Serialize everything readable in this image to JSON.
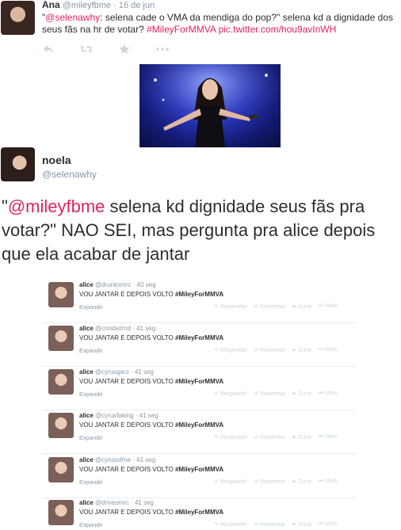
{
  "tweet1": {
    "name": "Ana",
    "handle": "@mileyfbme",
    "dot": "·",
    "date": "16 de jun",
    "text_open_quote": "\"",
    "mention": "@selenawhy",
    "text_body": ": selena cade o VMA da mendiga do pop?\" selena kd a dignidade dos seus fãs na hr de votar?",
    "hashtag": "#MileyForMMVA",
    "link": "pic.twitter.com/hou9avInWH",
    "actions": [
      "reply-icon",
      "retweet-icon",
      "favorite-icon",
      "more-icon"
    ]
  },
  "tweet2": {
    "name": "noela",
    "handle": "@selenawhy",
    "open_quote": "\"",
    "mention": "@mileyfbme",
    "text": " selena kd dignidade seus fãs pra votar?\" NAO SEI, mas pergunta pra alice depois que ela acabar de jantar"
  },
  "embedded_list": {
    "items": [
      {
        "name": "alice",
        "handle": "@drunksmrc",
        "time": "· 40 seg",
        "text": "VOU JANTAR E DEPOIS VOLTO",
        "hashtag": "#MileyForMMVA",
        "expand": "Expandir",
        "reply": "Responder",
        "retweet": "Retweetar",
        "fav": "Curtir",
        "more": "Mais"
      },
      {
        "name": "alice",
        "handle": "@cntsbetmd",
        "time": "· 41 seg",
        "text": "VOU JANTAR E DEPOIS VOLTO",
        "hashtag": "#MileyForMMVA",
        "expand": "Expandir",
        "reply": "Responder",
        "retweet": "Retweetar",
        "fav": "Curtir",
        "more": "Mais"
      },
      {
        "name": "alice",
        "handle": "@cyrusgerz",
        "time": "· 41 seg",
        "text": "VOU JANTAR E DEPOIS VOLTO",
        "hashtag": "#MileyForMMVA",
        "expand": "Expandir",
        "reply": "Responder",
        "retweet": "Retweetar",
        "fav": "Curtir",
        "more": "Mais"
      },
      {
        "name": "alice",
        "handle": "@cyrusfaking",
        "time": "· 41 seg",
        "text": "VOU JANTAR E DEPOIS VOLTO",
        "hashtag": "#MileyForMMVA",
        "expand": "Expandir",
        "reply": "Responder",
        "retweet": "Retweetar",
        "fav": "Curtir",
        "more": "Mais"
      },
      {
        "name": "alice",
        "handle": "@cyrusofme",
        "time": "· 41 seg",
        "text": "VOU JANTAR E DEPOIS VOLTO",
        "hashtag": "#MileyForMMVA",
        "expand": "Expandir",
        "reply": "Responder",
        "retweet": "Retweetar",
        "fav": "Curtir",
        "more": "Mais"
      },
      {
        "name": "alice",
        "handle": "@drivesmrc",
        "time": "· 41 seg",
        "text": "VOU JANTAR E DEPOIS VOLTO",
        "hashtag": "#MileyForMMVA",
        "expand": "Expandir",
        "reply": "Responder",
        "retweet": "Retweetar",
        "fav": "Curtir",
        "more": "Mais"
      }
    ]
  },
  "colors": {
    "accent_pink": "#e0245e",
    "link_blue": "#1e7fce",
    "muted_gray": "#8899a6"
  }
}
